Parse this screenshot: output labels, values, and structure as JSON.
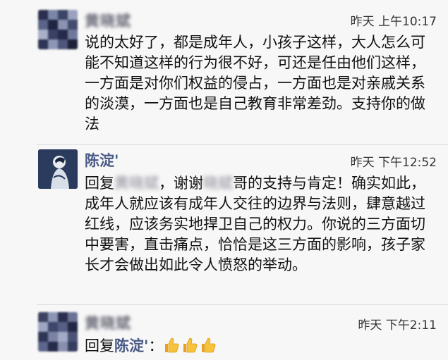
{
  "comments": [
    {
      "author": "黄晓斌",
      "time": "昨天 上午10:17",
      "text": "说的太好了，都是成年人，小孩子这样，大人怎么可能不知道这样的行为很不好，可还是任由他们这样，一方面是对你们权益的侵占，一方面也是对亲戚关系的淡漠，一方面也是自己教育非常差劲。支持你的做法"
    },
    {
      "author": "陈淀'",
      "time": "昨天 下午12:52",
      "reply_prefix": "回复",
      "reply_to": "黄晓斌",
      "text_before": "，谢谢",
      "masked": "晓斌",
      "text_after": "哥的支持与肯定！确实如此，成年人就应该有成年人交往的边界与法则，肆意越过红线，应该务实地捍卫自己的权力。你说的三方面切中要害，直击痛点，恰恰是这三方面的影响，孩子家长才会做出如此令人愤怒的举动。"
    },
    {
      "author": "黄晓斌",
      "time": "昨天 下午2:11",
      "reply_prefix": "回复",
      "reply_to": "陈淀'",
      "suffix": "：",
      "emoji": [
        "thumbs-up",
        "thumbs-up",
        "thumbs-up"
      ]
    }
  ]
}
